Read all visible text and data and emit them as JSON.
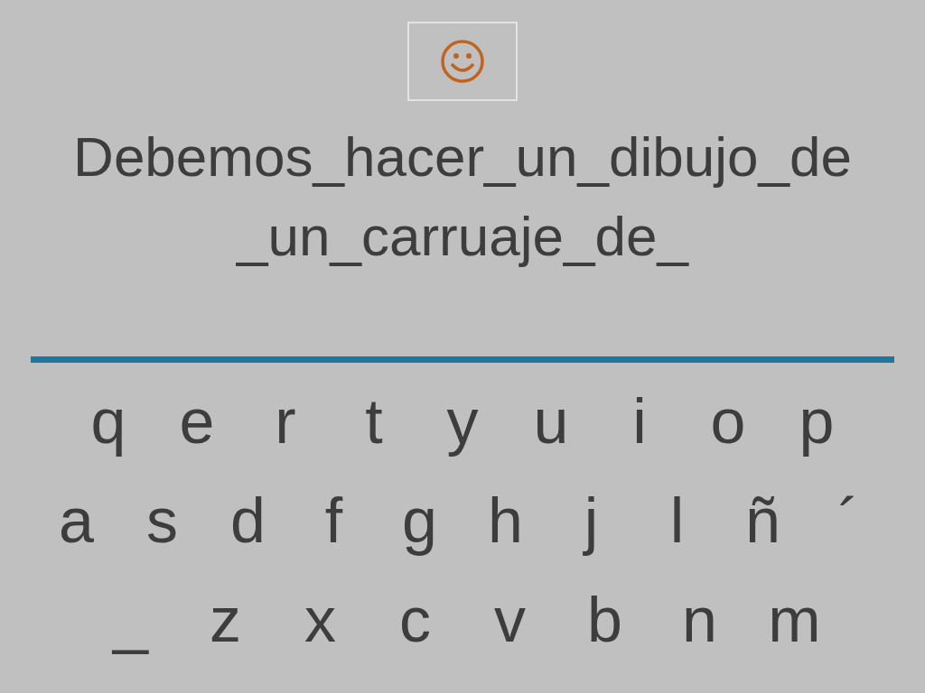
{
  "phrase": [
    "Debemos_hacer_un_dibujo_de",
    "_un_carruaje_de_"
  ],
  "keyboard": [
    [
      "q",
      "e",
      "r",
      "t",
      "y",
      "u",
      "i",
      "o",
      "p"
    ],
    [
      "a",
      "s",
      "d",
      "f",
      "g",
      "h",
      "j",
      "l",
      "ñ",
      "´"
    ],
    [
      "_",
      "z",
      "x",
      "c",
      "v",
      "b",
      "n",
      "m"
    ]
  ]
}
